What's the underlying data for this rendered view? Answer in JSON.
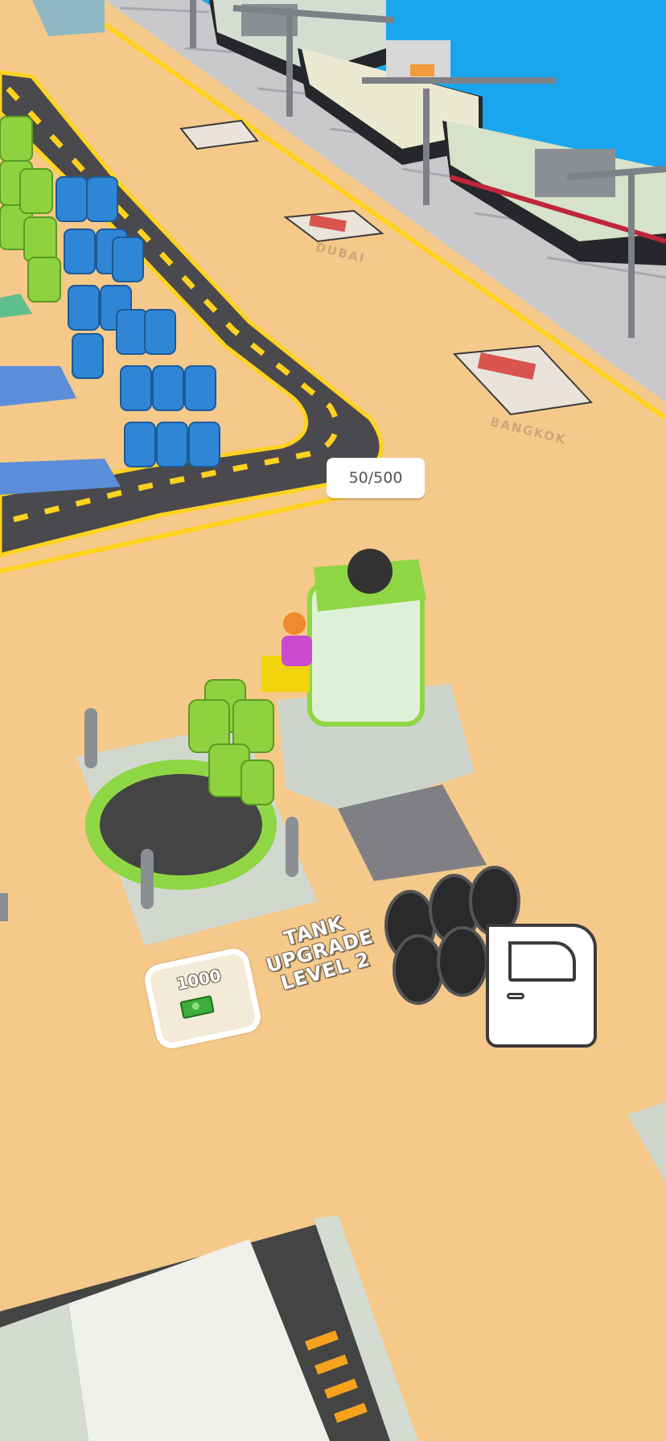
{
  "hud": {
    "capacity": "50/500"
  },
  "upgrade": {
    "cost": "1000",
    "title_line1": "TANK",
    "title_line2": "UPGRADE",
    "title_line3": "LEVEL 2"
  },
  "docks": {
    "dubai": "DUBAI",
    "bangkok": "BANGKOK"
  },
  "icons": {
    "door": "car-door-icon",
    "cash": "cash-icon"
  },
  "colors": {
    "ground": "#f5c98a",
    "water": "#1aa6ee",
    "road": "#4a4a4e",
    "road_marking": "#ffd21f",
    "oil_blue": "#2f86d6",
    "oil_green": "#8ed33f",
    "machine_green": "#8fd644"
  }
}
